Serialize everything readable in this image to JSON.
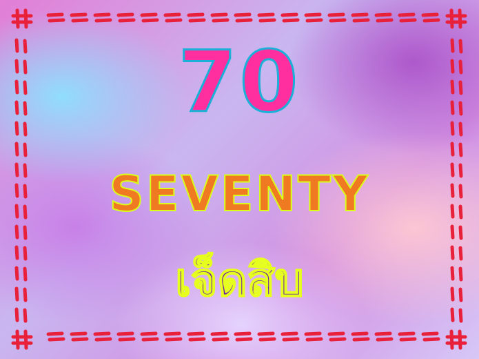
{
  "number_text": "70",
  "english_word": "SEVENTY",
  "thai_word": "เจ็ดสิบ",
  "colors": {
    "number_fill": "#ff2fa0",
    "number_outline": "#1ab0d8",
    "english_fill": "#f07a22",
    "english_outline": "#d9ff1a",
    "thai_fill": "#6b1ba8",
    "thai_outline": "#e6ff1f",
    "border_dash": "#e8203a"
  }
}
